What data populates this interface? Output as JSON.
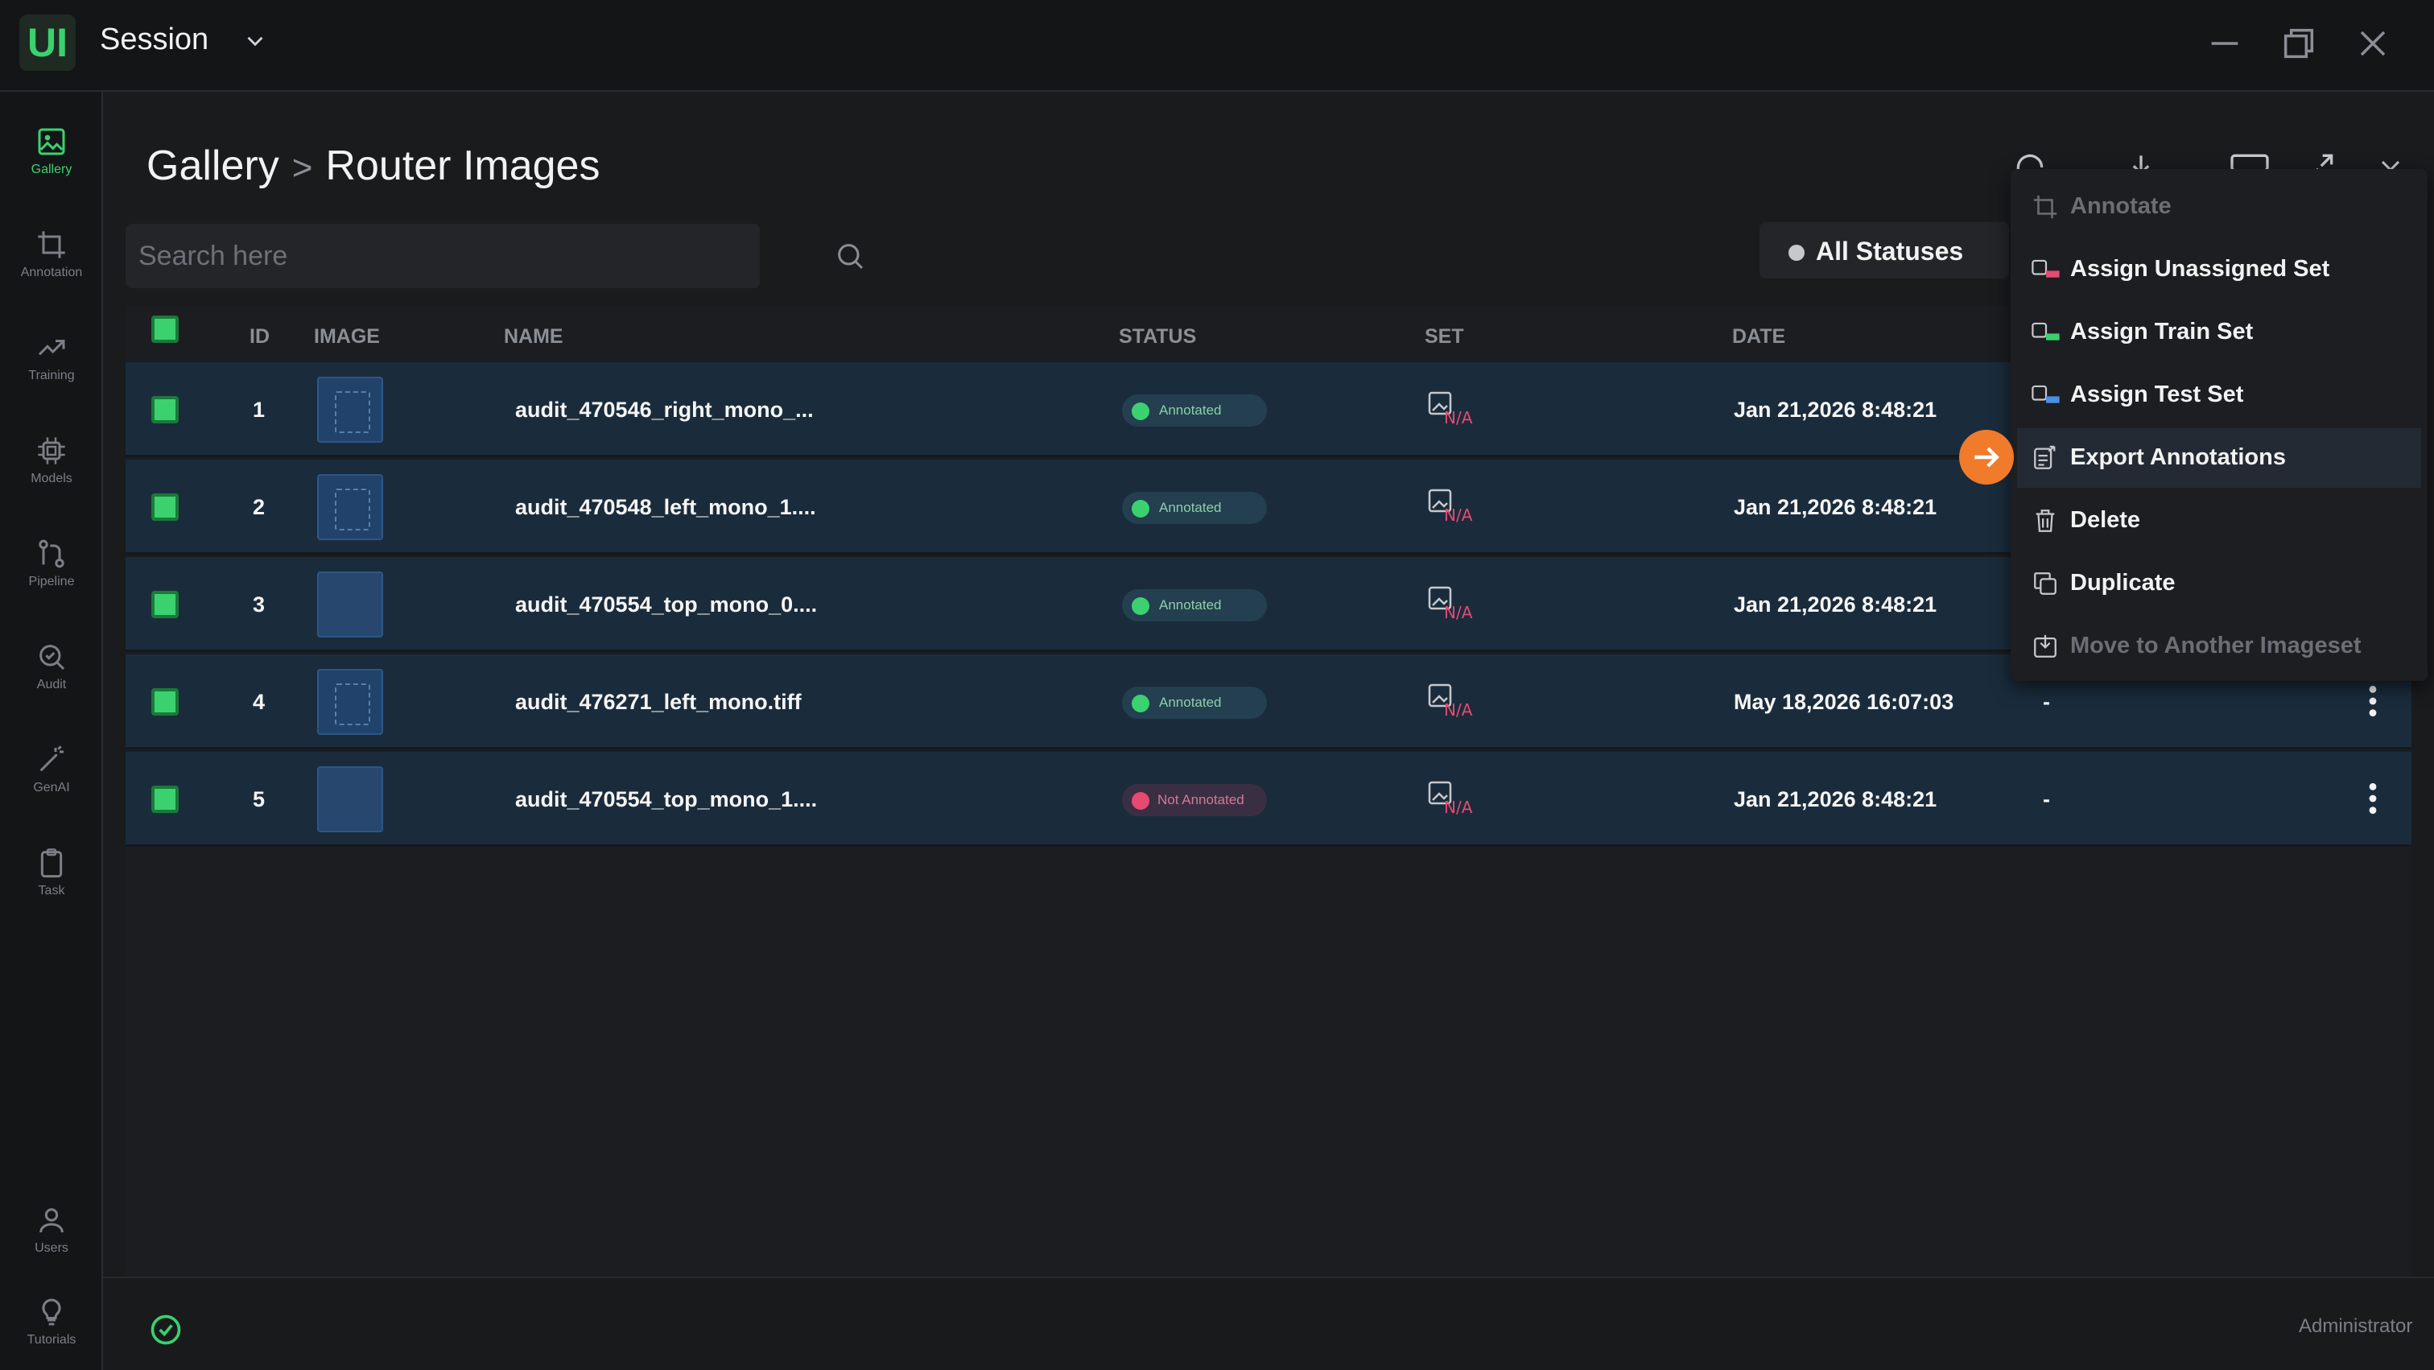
{
  "app": {
    "logo_text": "UI",
    "session_title": "Session"
  },
  "sidebar": {
    "items": [
      {
        "label": "Gallery",
        "icon": "gallery-icon",
        "active": true
      },
      {
        "label": "Annotation",
        "icon": "crop-icon"
      },
      {
        "label": "Training",
        "icon": "trend-icon"
      },
      {
        "label": "Models",
        "icon": "chip-icon"
      },
      {
        "label": "Pipeline",
        "icon": "pipeline-icon"
      },
      {
        "label": "Audit",
        "icon": "audit-search-icon"
      },
      {
        "label": "GenAI",
        "icon": "magic-wand-icon"
      },
      {
        "label": "Task",
        "icon": "clipboard-icon"
      },
      {
        "label": "Users",
        "icon": "user-icon"
      },
      {
        "label": "Tutorials",
        "icon": "lightbulb-icon"
      }
    ]
  },
  "breadcrumb": {
    "root": "Gallery",
    "separator": ">",
    "current": "Router Images"
  },
  "search": {
    "placeholder": "Search here",
    "value": ""
  },
  "status_filter": {
    "label": "All Statuses"
  },
  "table": {
    "columns": [
      "ID",
      "IMAGE",
      "NAME",
      "STATUS",
      "SET",
      "DATE"
    ],
    "rows": [
      {
        "id": "1",
        "name": "audit_470546_right_mono_...",
        "status": "Annotated",
        "set": "N/A",
        "date": "Jan 21,2026 8:48:21",
        "extra": ""
      },
      {
        "id": "2",
        "name": "audit_470548_left_mono_1....",
        "status": "Annotated",
        "set": "N/A",
        "date": "Jan 21,2026 8:48:21",
        "extra": ""
      },
      {
        "id": "3",
        "name": "audit_470554_top_mono_0....",
        "status": "Annotated",
        "set": "N/A",
        "date": "Jan 21,2026 8:48:21",
        "extra": ""
      },
      {
        "id": "4",
        "name": "audit_476271_left_mono.tiff",
        "status": "Annotated",
        "set": "N/A",
        "date": "May 18,2026 16:07:03",
        "extra": "-"
      },
      {
        "id": "5",
        "name": "audit_470554_top_mono_1....",
        "status": "Not Annotated",
        "set": "N/A",
        "date": "Jan 21,2026 8:48:21",
        "extra": "-"
      }
    ]
  },
  "context_menu": {
    "items": [
      {
        "label": "Annotate",
        "icon": "crop-icon",
        "disabled": true
      },
      {
        "label": "Assign Unassigned Set",
        "icon": "unassigned-set-icon"
      },
      {
        "label": "Assign Train Set",
        "icon": "train-set-icon"
      },
      {
        "label": "Assign Test Set",
        "icon": "test-set-icon"
      },
      {
        "label": "Export Annotations",
        "icon": "export-icon",
        "hover": true
      },
      {
        "label": "Delete",
        "icon": "trash-icon"
      },
      {
        "label": "Duplicate",
        "icon": "duplicate-icon"
      },
      {
        "label": "Move to Another Imageset",
        "icon": "move-icon",
        "disabled": true
      }
    ]
  },
  "footer": {
    "user_role": "Administrator"
  },
  "colors": {
    "accent_green": "#3bd16f",
    "row_bg": "#1a2c3c",
    "annotated_pill": "#233f50",
    "not_annotated_dot": "#e64a72",
    "highlight_arrow": "#f07b2b"
  }
}
